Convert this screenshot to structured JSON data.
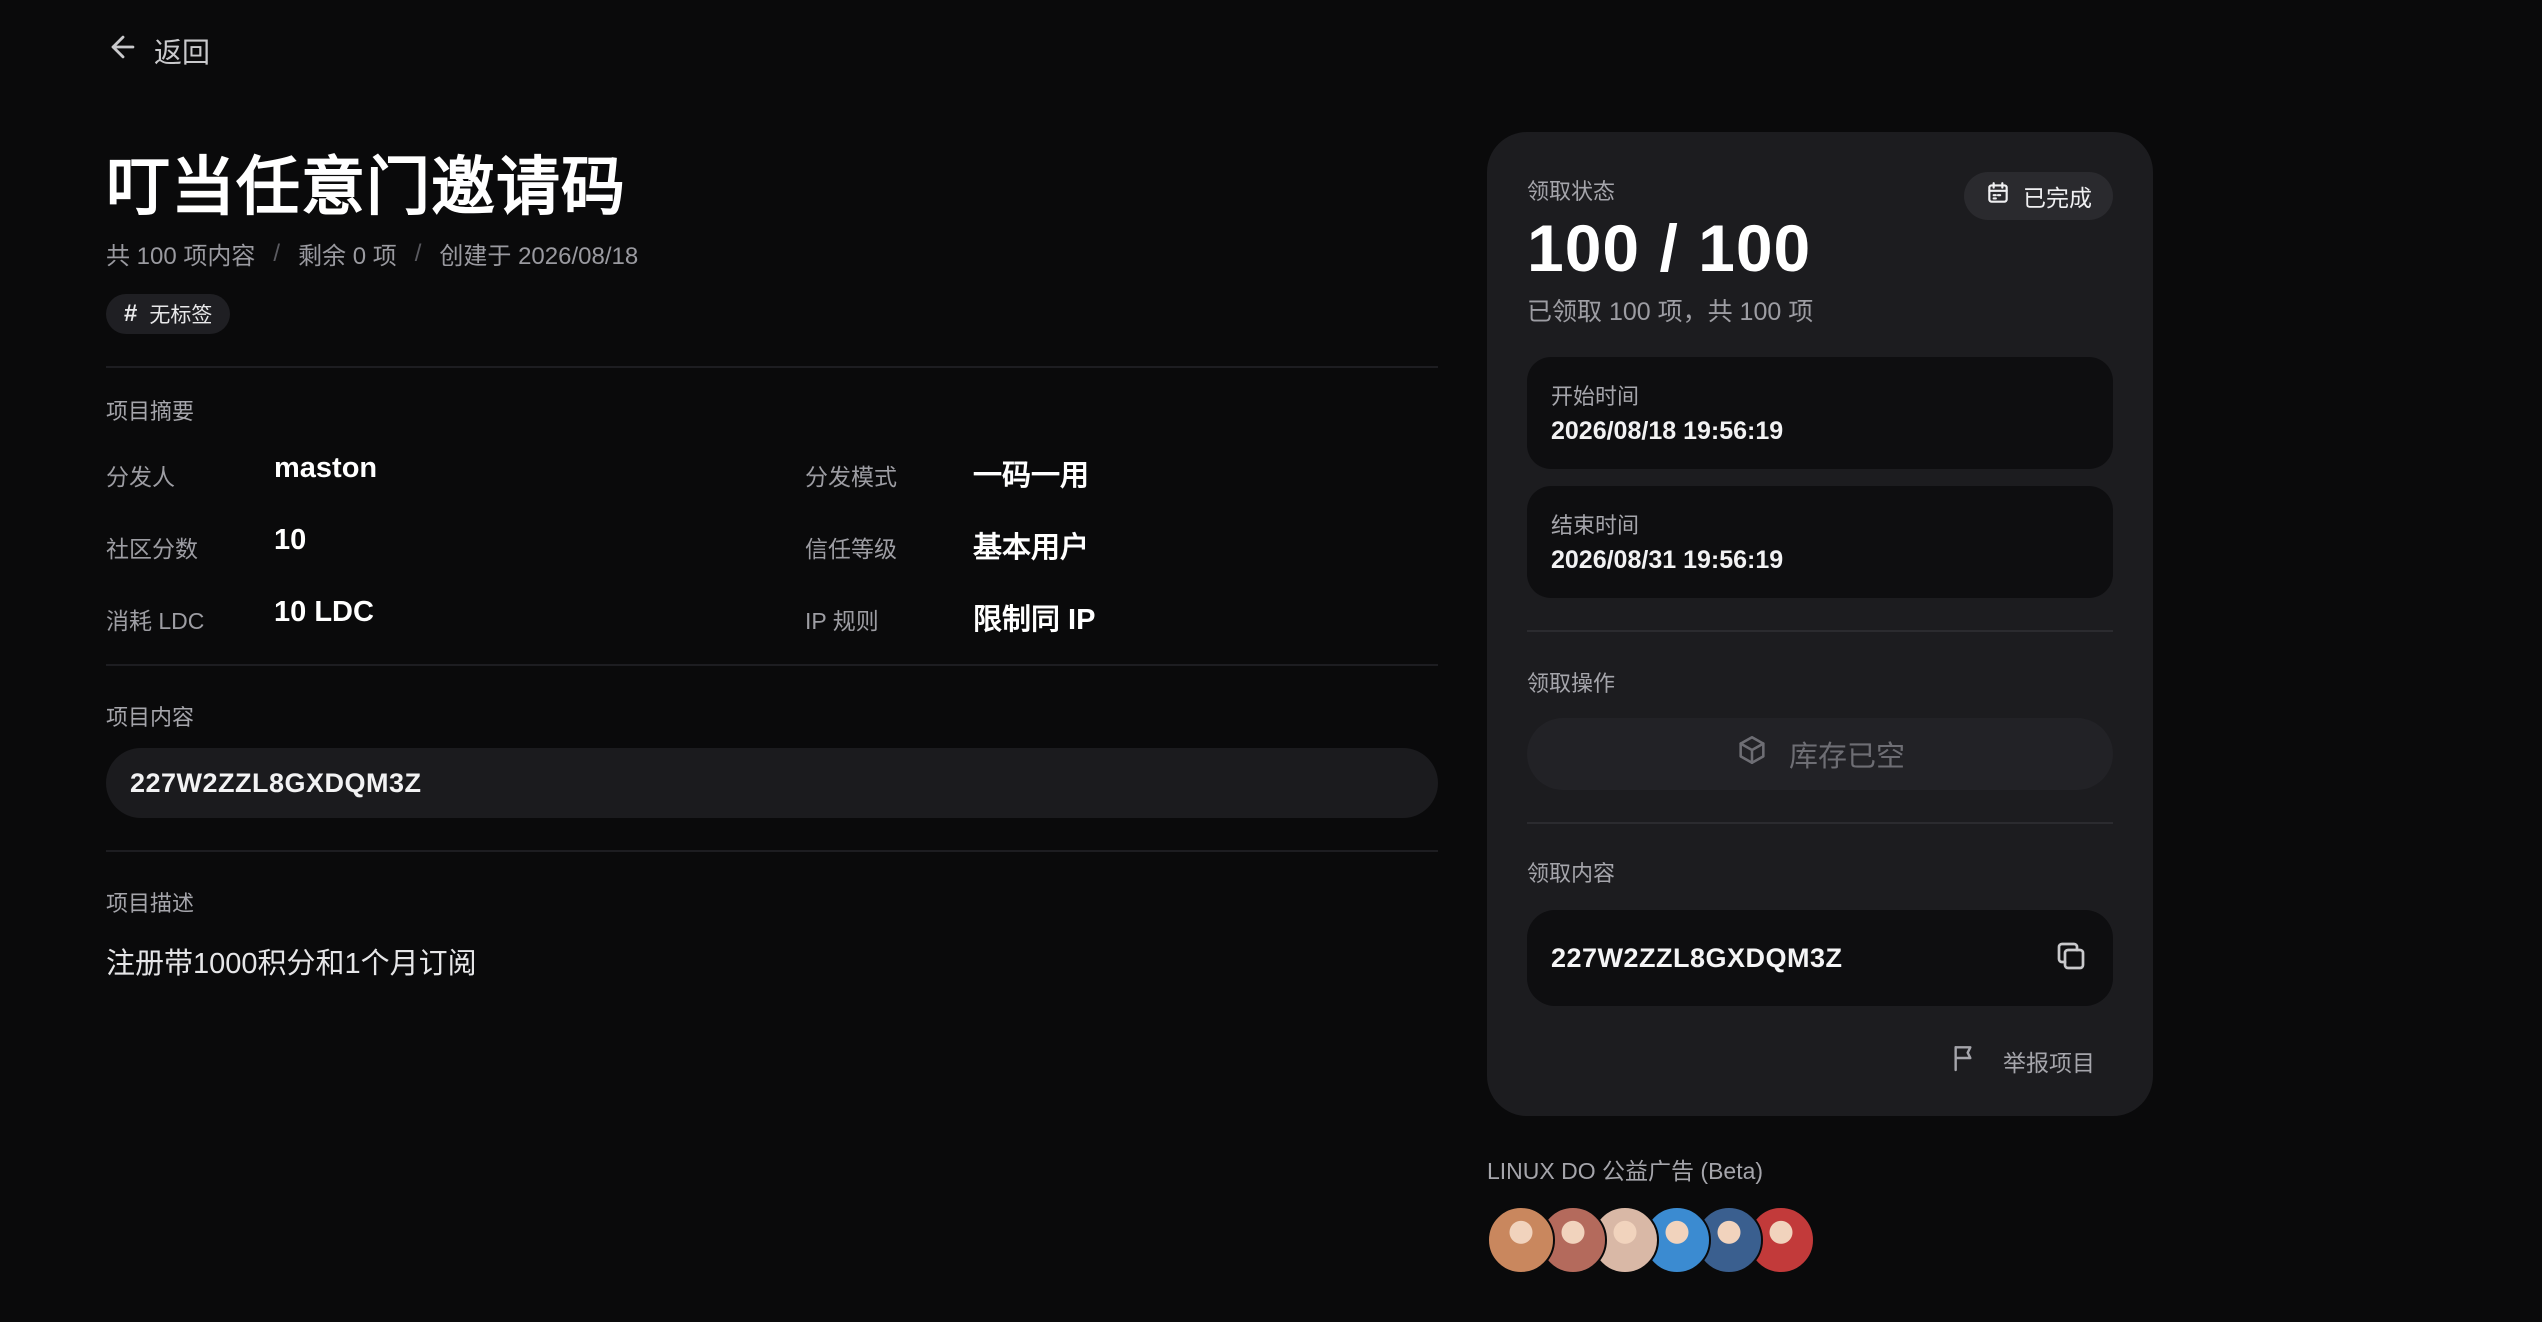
{
  "nav": {
    "back_label": "返回"
  },
  "project": {
    "title": "叮当任意门邀请码",
    "meta": {
      "total": "共 100 项内容",
      "remaining": "剩余 0 项",
      "created": "创建于 2026/08/18"
    },
    "tag": "无标签"
  },
  "summary": {
    "section_label": "项目摘要",
    "fields": [
      {
        "label": "分发人",
        "value": "maston"
      },
      {
        "label": "分发模式",
        "value": "一码一用"
      },
      {
        "label": "社区分数",
        "value": "10"
      },
      {
        "label": "信任等级",
        "value": "基本用户"
      },
      {
        "label": "消耗 LDC",
        "value": "10 LDC"
      },
      {
        "label": "IP 规则",
        "value": "限制同 IP"
      }
    ]
  },
  "content": {
    "section_label": "项目内容",
    "value": "227W2ZZL8GXDQM3Z"
  },
  "description": {
    "section_label": "项目描述",
    "text": "注册带1000积分和1个月订阅"
  },
  "panel": {
    "status_label": "领取状态",
    "status_badge": "已完成",
    "count": "100 / 100",
    "count_sub": "已领取 100 项，共 100 项",
    "start": {
      "label": "开始时间",
      "value": "2026/08/18 19:56:19"
    },
    "end": {
      "label": "结束时间",
      "value": "2026/08/31 19:56:19"
    },
    "action_label": "领取操作",
    "action_button": "库存已空",
    "claim_label": "领取内容",
    "claim_code": "227W2ZZL8GXDQM3Z",
    "report_label": "举报项目"
  },
  "ads": {
    "label": "LINUX DO 公益广告 (Beta)",
    "avatars": [
      {
        "color": "#c9875e"
      },
      {
        "color": "#b46a5c"
      },
      {
        "color": "#d9b8a6"
      },
      {
        "color": "#3b8bd1"
      },
      {
        "color": "#3a5f8f"
      },
      {
        "color": "#c23a3a"
      }
    ]
  },
  "colors": {
    "background": "#0a0a0b",
    "panel": "#1c1c1f",
    "card": "#0e0e10"
  }
}
